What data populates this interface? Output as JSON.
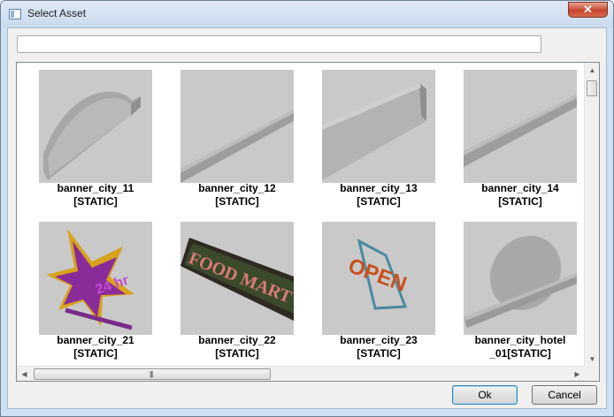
{
  "window": {
    "title": "Select Asset",
    "close_label": "✕"
  },
  "search": {
    "value": "",
    "placeholder": ""
  },
  "assets": [
    {
      "name": "banner_city_11",
      "type": "[STATIC]"
    },
    {
      "name": "banner_city_12",
      "type": "[STATIC]"
    },
    {
      "name": "banner_city_13",
      "type": "[STATIC]"
    },
    {
      "name": "banner_city_14",
      "type": "[STATIC]"
    },
    {
      "name": "banner_city_21",
      "type": "[STATIC]"
    },
    {
      "name": "banner_city_22",
      "type": "[STATIC]"
    },
    {
      "name": "banner_city_23",
      "type": "[STATIC]"
    },
    {
      "name": "banner_city_hotel",
      "type": "_01[STATIC]"
    }
  ],
  "thumb_text": {
    "food_mart": "FOOD MART",
    "open": "OPEN",
    "badge": "24 hr"
  },
  "scrollbar": {
    "up": "▲",
    "down": "▼",
    "left": "◀",
    "right": "▶",
    "grip": "|||"
  },
  "buttons": {
    "ok": "Ok",
    "cancel": "Cancel"
  },
  "colors": {
    "accent": "#3c7fb1",
    "thumb_bg": "#c9c9c9",
    "close": "#c7442c"
  }
}
